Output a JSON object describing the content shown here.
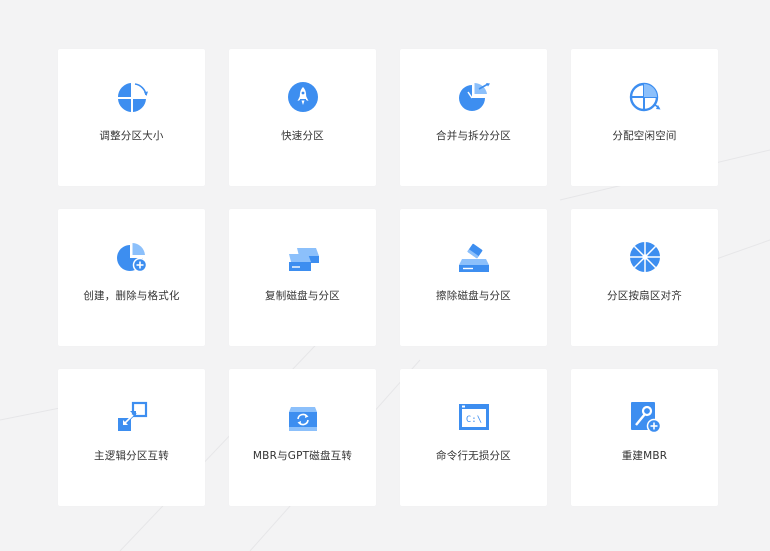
{
  "colors": {
    "primary": "#3d8ef0",
    "light": "#8cc0fb",
    "background": "#f3f3f4",
    "card": "#ffffff",
    "text": "#333333"
  },
  "features": [
    {
      "label": "调整分区大小",
      "icon": "resize-partition-icon"
    },
    {
      "label": "快速分区",
      "icon": "rocket-icon"
    },
    {
      "label": "合并与拆分分区",
      "icon": "merge-split-pie-icon"
    },
    {
      "label": "分配空闲空间",
      "icon": "allocate-space-icon"
    },
    {
      "label": "创建，删除与格式化",
      "icon": "create-partition-icon"
    },
    {
      "label": "复制磁盘与分区",
      "icon": "copy-disk-icon"
    },
    {
      "label": "擦除磁盘与分区",
      "icon": "wipe-disk-icon"
    },
    {
      "label": "分区按扇区对齐",
      "icon": "sector-align-icon"
    },
    {
      "label": "主逻辑分区互转",
      "icon": "primary-logical-convert-icon"
    },
    {
      "label": "MBR与GPT磁盘互转",
      "icon": "mbr-gpt-convert-icon"
    },
    {
      "label": "命令行无损分区",
      "icon": "command-line-icon"
    },
    {
      "label": "重建MBR",
      "icon": "rebuild-mbr-icon"
    }
  ]
}
